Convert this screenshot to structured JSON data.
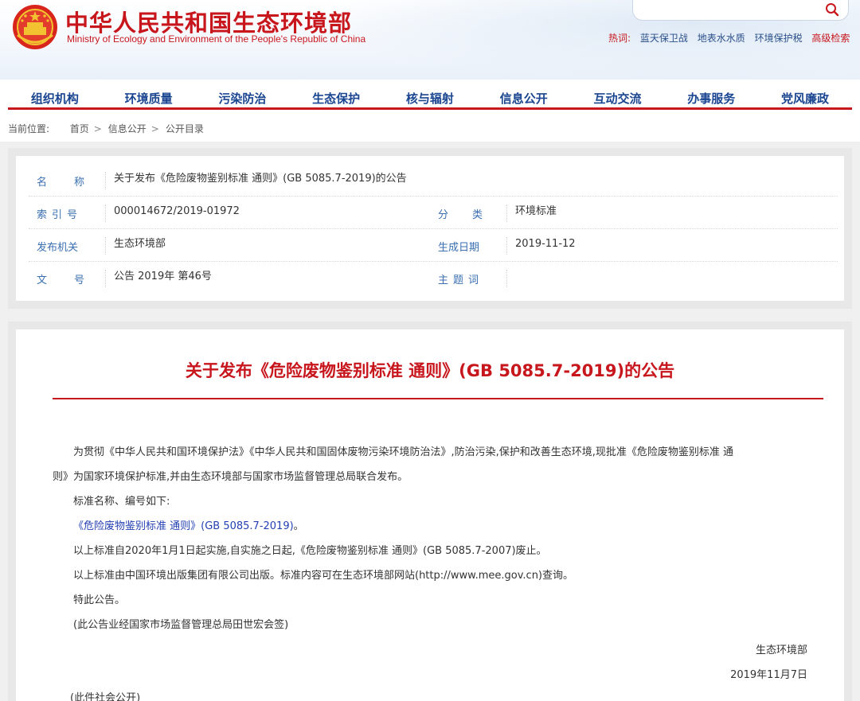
{
  "header": {
    "title_cn": "中华人民共和国生态环境部",
    "title_en": "Ministry of Ecology and Environment of the People's Republic of China",
    "search_placeholder": "",
    "hotwords_label": "热词:",
    "hotwords": [
      "蓝天保卫战",
      "地表水水质",
      "环境保护税"
    ],
    "advanced_search": "高级检索"
  },
  "nav": {
    "items": [
      "组织机构",
      "环境质量",
      "污染防治",
      "生态保护",
      "核与辐射",
      "信息公开",
      "互动交流",
      "办事服务",
      "党风廉政"
    ]
  },
  "breadcrumb": {
    "label": "当前位置:",
    "items": [
      "首页",
      "信息公开",
      "公开目录"
    ],
    "separator": ">"
  },
  "meta": {
    "name_label": "名称",
    "name_value": "关于发布《危险废物鉴别标准 通则》(GB 5085.7-2019)的公告",
    "index_label": "索引号",
    "index_value": "000014672/2019-01972",
    "category_label": "分类",
    "category_value": "环境标准",
    "issuer_label": "发布机关",
    "issuer_value": "生态环境部",
    "date_label": "生成日期",
    "date_value": "2019-11-12",
    "docno_label": "文号",
    "docno_value": "公告 2019年 第46号",
    "subject_label": "主题词",
    "subject_value": ""
  },
  "article": {
    "title": "关于发布《危险废物鉴别标准 通则》(GB 5085.7-2019)的公告",
    "p1_line1": "为贯彻《中华人民共和国环境保护法》《中华人民共和国固体废物污染环境防治法》,防治污染,保护和改善生态环境,现批准《危险废物鉴别标准 通",
    "p1_line2": "则》为国家环境保护标准,并由生态环境部与国家市场监督管理总局联合发布。",
    "p2": "标准名称、编号如下:",
    "p3_link": "《危险废物鉴别标准 通则》(GB 5085.7-2019)",
    "p3_tail": "。",
    "p4": "以上标准自2020年1月1日起实施,自实施之日起,《危险废物鉴别标准 通则》(GB 5085.7-2007)废止。",
    "p5": "以上标准由中国环境出版集团有限公司出版。标准内容可在生态环境部网站(http://www.mee.gov.cn)查询。",
    "p6": "特此公告。",
    "p7": "(此公告业经国家市场监督管理总局田世宏会签)",
    "signer": "生态环境部",
    "sign_date": "2019年11月7日",
    "public_note": "(此件社会公开)"
  },
  "colors": {
    "brand_red": "#c8161d",
    "nav_blue": "#1a4591",
    "label_blue": "#3a6fb2",
    "link_blue": "#2440b3"
  }
}
